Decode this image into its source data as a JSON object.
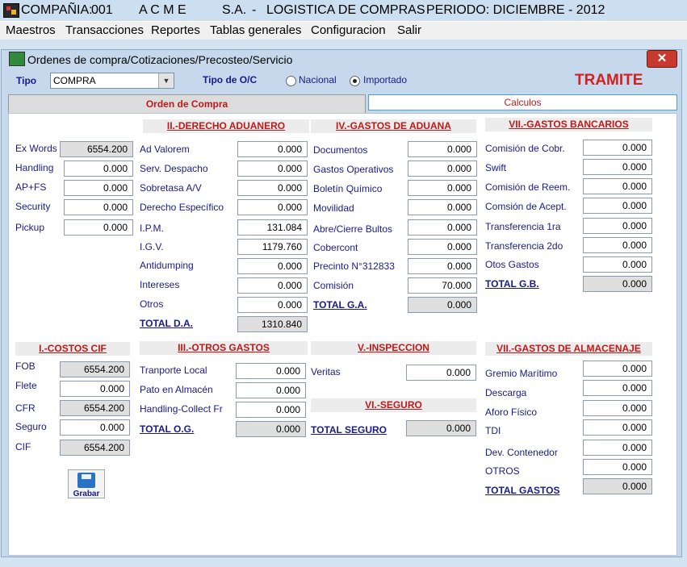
{
  "titlebar": {
    "company_label": "COMPAÑIA:",
    "company_code": "001",
    "company_name": "A C M E",
    "company_type": "S.A.",
    "sep1": "-",
    "module": "LOGISTICA DE COMPRAS",
    "sep2": "-",
    "period": "PERIODO: DICIEMBRE - 2012"
  },
  "menu": [
    "Maestros",
    "Transacciones",
    "Reportes",
    "Tablas generales",
    "Configuracion",
    "Salir"
  ],
  "window": {
    "title": "Ordenes de compra/Cotizaciones/Precosteo/Servicio",
    "close_symbol": "✕"
  },
  "form": {
    "tipo_label": "Tipo",
    "tipo_value": "COMPRA",
    "tipo_oc_label": "Tipo de O/C",
    "radio_nacional": "Nacional",
    "radio_importado": "Importado",
    "selected": "Importado",
    "status": "TRAMITE"
  },
  "tabs": {
    "orden": "Orden de Compra",
    "calculos": "Calculos"
  },
  "left": {
    "ex_words": {
      "label": "Ex Words",
      "value": "6554.200"
    },
    "handling": {
      "label": "Handling",
      "value": "0.000"
    },
    "ap_fs": {
      "label": "AP+FS",
      "value": "0.000"
    },
    "security": {
      "label": "Security",
      "value": "0.000"
    },
    "pickup": {
      "label": "Pickup",
      "value": "0.000"
    }
  },
  "derecho": {
    "header": "II.-DERECHO ADUANERO",
    "rows": [
      {
        "label": "Ad Valorem",
        "value": "0.000"
      },
      {
        "label": "Serv. Despacho",
        "value": "0.000"
      },
      {
        "label": "Sobretasa A/V",
        "value": "0.000"
      },
      {
        "label": "Derecho Específico",
        "value": "0.000"
      },
      {
        "label": "I.P.M.",
        "value": "131.084"
      },
      {
        "label": "I.G.V.",
        "value": "1179.760"
      },
      {
        "label": "Antidumping",
        "value": "0.000"
      },
      {
        "label": "Intereses",
        "value": "0.000"
      },
      {
        "label": "Otros",
        "value": "0.000"
      }
    ],
    "total_label": "TOTAL D.A.",
    "total_value": "1310.840"
  },
  "aduana": {
    "header": "IV.-GASTOS DE ADUANA",
    "rows": [
      {
        "label": "Documentos",
        "value": "0.000"
      },
      {
        "label": "Gastos Operativos",
        "value": "0.000"
      },
      {
        "label": "Boletín Químico",
        "value": "0.000"
      },
      {
        "label": "Movilidad",
        "value": "0.000"
      },
      {
        "label": "Abre/Cierre Bultos",
        "value": "0.000"
      },
      {
        "label": "Cobercont",
        "value": "0.000"
      },
      {
        "label": "Precinto N°312833",
        "value": "0.000"
      },
      {
        "label": "Comisión",
        "value": "70.000"
      }
    ],
    "total_label": "TOTAL G.A.",
    "total_value": "0.000"
  },
  "bancarios": {
    "header": "VII.-GASTOS BANCARIOS",
    "rows": [
      {
        "label": "Comisión de Cobr.",
        "value": "0.000"
      },
      {
        "label": "Swift",
        "value": "0.000"
      },
      {
        "label": "Comisión de Reem.",
        "value": "0.000"
      },
      {
        "label": "Comsión de Acept.",
        "value": "0.000"
      },
      {
        "label": "Transferencia 1ra",
        "value": "0.000"
      },
      {
        "label": "Transferencia 2do",
        "value": "0.000"
      },
      {
        "label": "Otos Gastos",
        "value": "0.000"
      }
    ],
    "total_label": "TOTAL G.B.",
    "total_value": "0.000"
  },
  "cif": {
    "header": "I.-COSTOS CIF",
    "rows": [
      {
        "label": "FOB",
        "value": "6554.200"
      },
      {
        "label": "Flete",
        "value": "0.000"
      },
      {
        "label": "CFR",
        "value": "6554.200"
      },
      {
        "label": "Seguro",
        "value": "0.000"
      },
      {
        "label": "CIF",
        "value": "6554.200"
      }
    ]
  },
  "otros": {
    "header": "III.-OTROS GASTOS",
    "rows": [
      {
        "label": "Tranporte Local",
        "value": "0.000"
      },
      {
        "label": "Pato en Almacén",
        "value": "0.000"
      },
      {
        "label": "Handling-Collect Fr",
        "value": "0.000"
      }
    ],
    "total_label": "TOTAL O.G.",
    "total_value": "0.000"
  },
  "inspeccion": {
    "header": "V.-INSPECCION",
    "label": "Veritas",
    "value": "0.000"
  },
  "seguro": {
    "header": "VI.-SEGURO",
    "total_label": "TOTAL SEGURO",
    "total_value": "0.000"
  },
  "almacenaje": {
    "header": "VII.-GASTOS DE ALMACENAJE",
    "rows": [
      {
        "label": "Gremio Marítimo",
        "value": "0.000"
      },
      {
        "label": "Descarga",
        "value": "0.000"
      },
      {
        "label": "Aforo Físico",
        "value": "0.000"
      },
      {
        "label": "TDI",
        "value": "0.000"
      },
      {
        "label": "Dev. Contenedor",
        "value": "0.000"
      },
      {
        "label": "OTROS",
        "value": "0.000"
      }
    ],
    "total_label": "TOTAL GASTOS",
    "total_value": "0.000"
  },
  "save_label": "Grabar",
  "icons": {
    "app": "app-icon",
    "window": "form-icon",
    "save": "floppy-disk-icon",
    "close": "close-icon",
    "dropdown": "chevron-down-icon"
  }
}
